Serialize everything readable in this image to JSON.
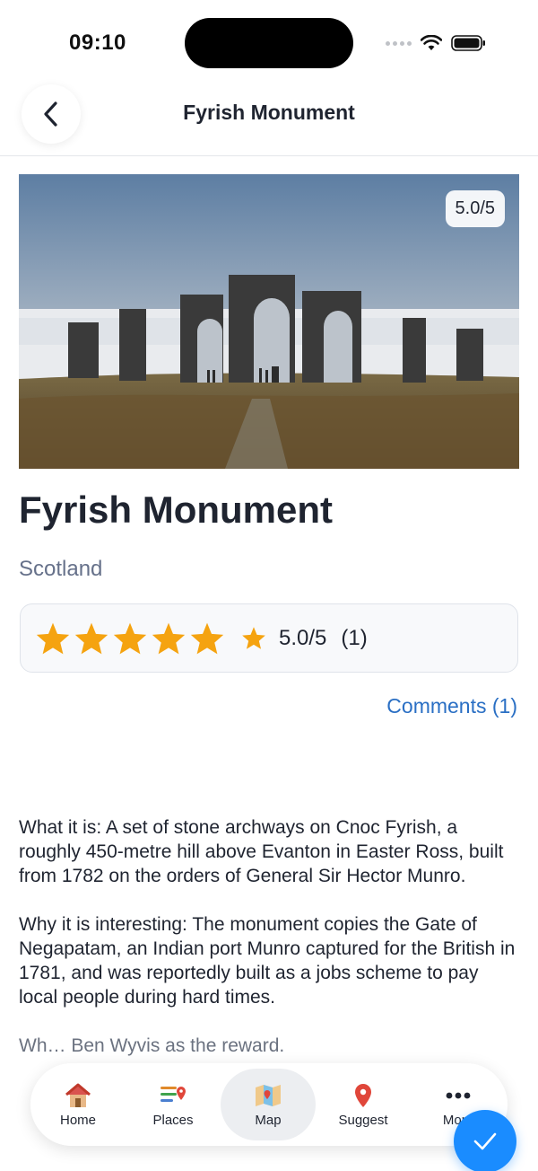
{
  "status": {
    "time": "09:10"
  },
  "header": {
    "title": "Fyrish Monument",
    "back_icon": "chevron-left-icon"
  },
  "hero": {
    "rating_badge": "5.0/5"
  },
  "place": {
    "name": "Fyrish Monument",
    "region": "Scotland"
  },
  "rating": {
    "value": 5.0,
    "text": "5.0/5",
    "count": "(1)",
    "star_color": "#f5a310"
  },
  "comments": {
    "label": "Comments (1)"
  },
  "description": [
    "What it is: A set of stone archways on Cnoc Fyrish, a roughly 450-metre hill above Evanton in Easter Ross, built from 1782 on the orders of General Sir Hector Munro.",
    "Why it is interesting: The monument copies the Gate of Negapatam, an Indian port Munro captured for the British in 1781, and was reportedly built as a jobs scheme to pay local people during hard times.",
    "Wh… Ben Wyvis as the reward."
  ],
  "nav": {
    "items": [
      {
        "label": "Home",
        "icon": "house-icon"
      },
      {
        "label": "Places",
        "icon": "list-pin-icon"
      },
      {
        "label": "Map",
        "icon": "map-icon"
      },
      {
        "label": "Suggest",
        "icon": "pin-icon"
      },
      {
        "label": "More",
        "icon": "ellipsis-icon"
      }
    ],
    "active": "Map"
  },
  "fab": {
    "icon": "checkmark-icon",
    "color": "#1a8cff"
  }
}
